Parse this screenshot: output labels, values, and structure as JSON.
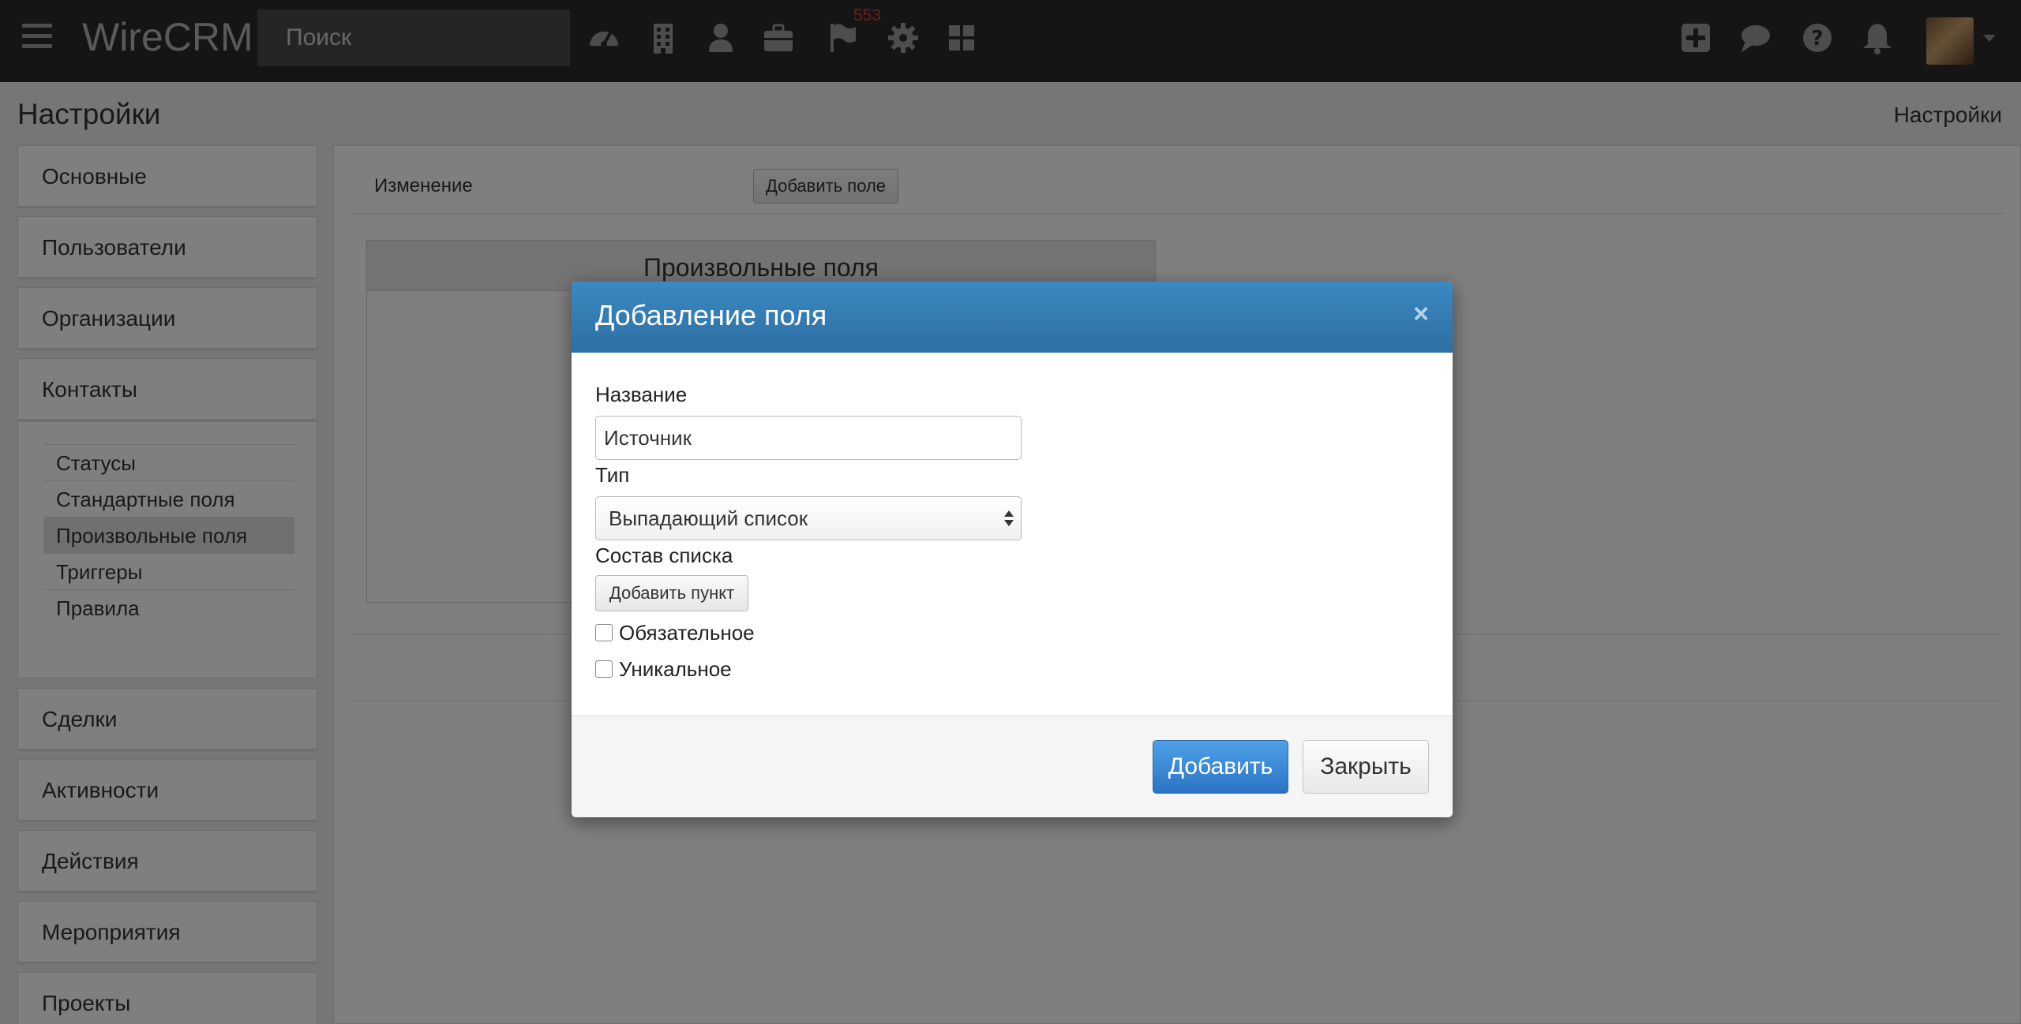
{
  "app": {
    "brand": "WireCRM"
  },
  "topbar": {
    "search_placeholder": "Поиск",
    "icons": [
      "dashboard-icon",
      "building-icon",
      "user-icon",
      "briefcase-icon",
      "flag-icon",
      "gear-icon",
      "grid-icon",
      "plus-square-icon",
      "chat-icon",
      "help-icon",
      "bell-icon"
    ],
    "flag_badge": "553"
  },
  "header": {
    "title": "Настройки",
    "breadcrumb": "Настройки"
  },
  "sidebar": {
    "items": [
      {
        "label": "Основные"
      },
      {
        "label": "Пользователи"
      },
      {
        "label": "Организации"
      },
      {
        "label": "Контакты"
      },
      {
        "label": "Сделки"
      },
      {
        "label": "Активности"
      },
      {
        "label": "Действия"
      },
      {
        "label": "Мероприятия"
      },
      {
        "label": "Проекты"
      }
    ],
    "sub_items": [
      {
        "label": "Статусы"
      },
      {
        "label": "Стандартные поля"
      },
      {
        "label": "Произвольные поля",
        "active": true
      },
      {
        "label": "Триггеры"
      },
      {
        "label": "Правила"
      }
    ]
  },
  "main": {
    "edit_label": "Изменение",
    "add_field_button": "Добавить поле",
    "fields_box_title": "Произвольные поля"
  },
  "modal": {
    "title": "Добавление поля",
    "close": "×",
    "name_label": "Название",
    "name_value": "Источник",
    "type_label": "Тип",
    "type_value": "Выпадающий список",
    "list_label": "Состав списка",
    "add_item_button": "Добавить пункт",
    "required_label": "Обязательное",
    "required_checked": false,
    "unique_label": "Уникальное",
    "unique_checked": false,
    "add_button": "Добавить",
    "close_button": "Закрыть"
  },
  "colors": {
    "topbar": "#2b2b2b",
    "modal_header": "#3376ae",
    "primary": "#3a8bd8",
    "badge": "#e2393a"
  }
}
